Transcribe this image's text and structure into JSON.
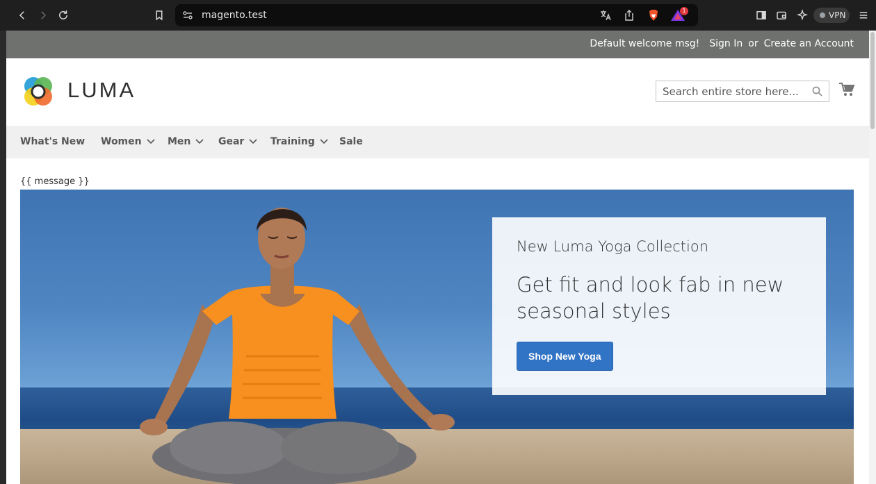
{
  "browser": {
    "url": "magento.test",
    "vpn_label": "VPN",
    "notification_count": "1"
  },
  "store": {
    "welcome": "Default welcome msg!",
    "sign_in": "Sign In",
    "or": "or",
    "create_account": "Create an Account",
    "logo_text": "LUMA",
    "search_placeholder": "Search entire store here..."
  },
  "nav": {
    "items": [
      {
        "label": "What's New",
        "dropdown": false
      },
      {
        "label": "Women",
        "dropdown": true
      },
      {
        "label": "Men",
        "dropdown": true
      },
      {
        "label": "Gear",
        "dropdown": true
      },
      {
        "label": "Training",
        "dropdown": true
      },
      {
        "label": "Sale",
        "dropdown": false
      }
    ]
  },
  "message": "{{ message }}",
  "hero": {
    "subtitle": "New Luma Yoga Collection",
    "headline": "Get fit and look fab in new seasonal styles",
    "cta": "Shop New Yoga"
  },
  "colors": {
    "top_panel": "#6e716e",
    "nav_bg": "#f0f0f0",
    "cta_blue": "#3173c4",
    "sky_blue": "#4f86c2"
  },
  "icons": [
    "back-icon",
    "forward-icon",
    "reload-icon",
    "bookmark-icon",
    "site-settings-icon",
    "translate-icon",
    "share-icon",
    "brave-shield-icon",
    "brave-rewards-icon",
    "sidebar-icon",
    "wallet-icon",
    "leo-ai-icon",
    "menu-icon",
    "search-icon",
    "cart-icon"
  ]
}
